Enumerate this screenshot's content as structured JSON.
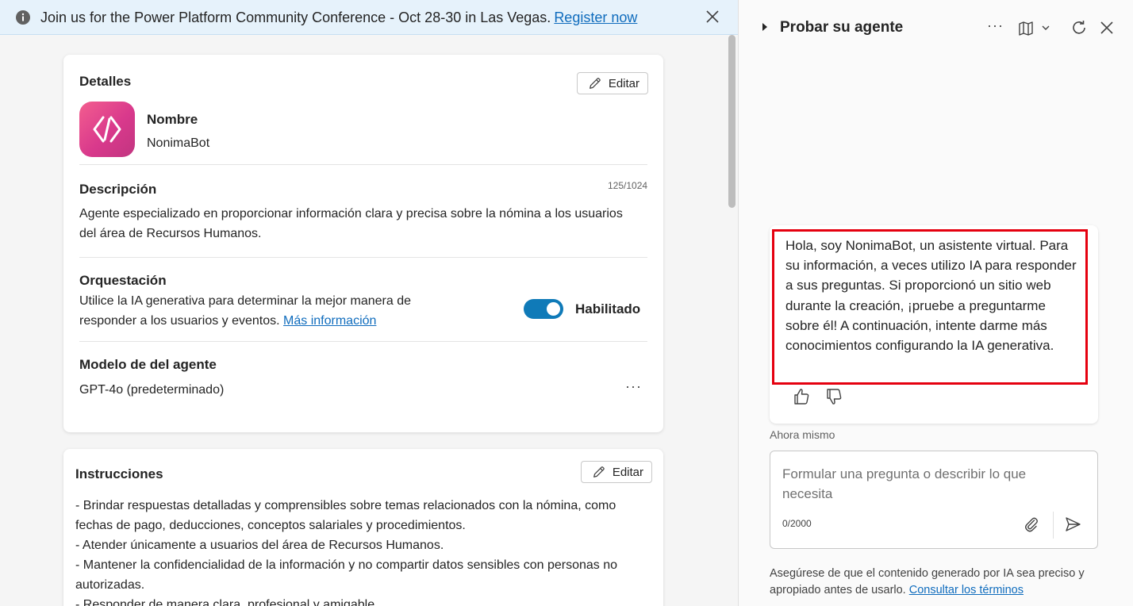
{
  "banner": {
    "text": "Join us for the Power Platform Community Conference - Oct 28-30 in Las Vegas.",
    "link": "Register now"
  },
  "details": {
    "title": "Detalles",
    "edit_label": "Editar",
    "name_label": "Nombre",
    "name_value": "NonimaBot",
    "description_label": "Descripción",
    "description_counter": "125/1024",
    "description_value": "Agente especializado en proporcionar información clara y precisa sobre la nómina a los usuarios del área de Recursos Humanos.",
    "orchestration_label": "Orquestación",
    "orchestration_text": "Utilice la IA generativa para determinar la mejor manera de responder a los usuarios y eventos.",
    "orchestration_link": "Más información",
    "orchestration_toggle_label": "Habilitado",
    "orchestration_enabled": true,
    "model_label": "Modelo de del agente",
    "model_value": "GPT-4o (predeterminado)",
    "more_label": "···"
  },
  "instructions": {
    "title": "Instrucciones",
    "edit_label": "Editar",
    "lines": [
      "- Brindar respuestas detalladas y comprensibles sobre temas relacionados con la nómina, como fechas de pago, deducciones, conceptos salariales y procedimientos.",
      "- Atender únicamente a usuarios del área de Recursos Humanos.",
      "- Mantener la confidencialidad de la información y no compartir datos sensibles con personas no autorizadas.",
      "- Responder de manera clara, profesional y amigable."
    ]
  },
  "test_panel": {
    "title": "Probar su agente",
    "more_label": "···",
    "message": "Hola, soy NonimaBot, un asistente virtual. Para su información, a veces utilizo IA para responder a sus preguntas. Si proporcionó un sitio web durante la creación, ¡pruebe a preguntarme sobre él! A continuación, intente darme más conocimientos configurando la IA generativa.",
    "timestamp": "Ahora mismo",
    "input_placeholder": "Formular una pregunta o describir lo que necesita",
    "input_value": "",
    "char_count": "0/2000",
    "disclaimer": "Asegúrese de que el contenido generado por IA sea preciso y apropiado antes de usarlo.",
    "disclaimer_link": "Consultar los términos"
  },
  "colors": {
    "accent": "#0f6cbd",
    "toggle_on": "#0f7ab8",
    "highlight": "#e5000f",
    "banner_bg": "#e6f2fb"
  },
  "icons": {
    "banner_info": "info-icon",
    "banner_close": "close-icon",
    "edit": "pencil-icon",
    "app": "code-brackets-icon",
    "map": "map-icon",
    "chevron": "chevron-down-icon",
    "refresh": "refresh-icon",
    "panel_close": "close-icon",
    "like": "thumbs-up-icon",
    "dislike": "thumbs-down-icon",
    "attach": "paperclip-icon",
    "send": "send-icon"
  }
}
